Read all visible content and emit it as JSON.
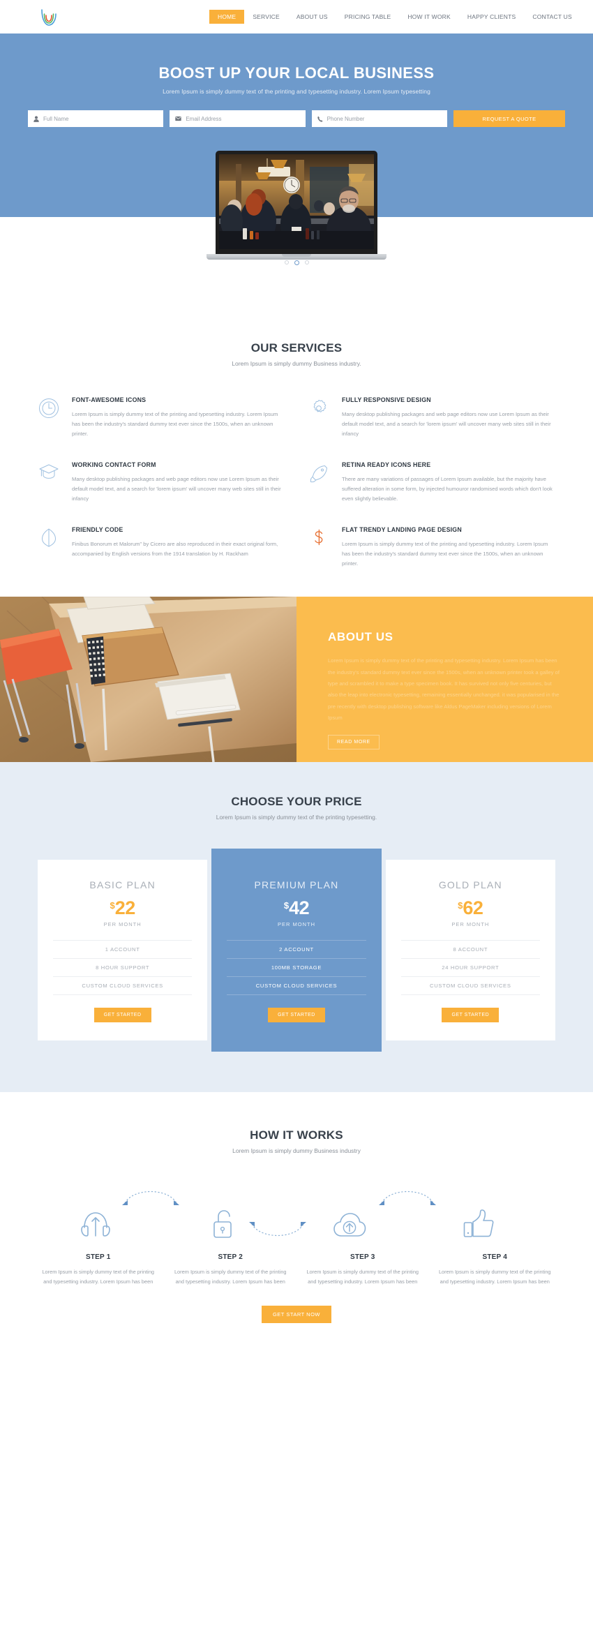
{
  "brand": {
    "logo_name": "rainbow-arc-logo",
    "colors": {
      "accent_orange": "#f9b03a",
      "accent_blue": "#6e9acb",
      "about_yellow": "#fbbc4e",
      "pricing_bg": "#e6edf5",
      "heading": "#38414b",
      "body_text": "#9aa0a8"
    }
  },
  "nav": {
    "items": [
      {
        "label": "HOME",
        "active": true
      },
      {
        "label": "SERVICE",
        "active": false
      },
      {
        "label": "ABOUT US",
        "active": false
      },
      {
        "label": "PRICING TABLE",
        "active": false
      },
      {
        "label": "HOW IT WORK",
        "active": false
      },
      {
        "label": "HAPPY CLIENTS",
        "active": false
      },
      {
        "label": "CONTACT US",
        "active": false
      }
    ]
  },
  "hero": {
    "title": "BOOST UP YOUR LOCAL BUSINESS",
    "subtitle": "Lorem Ipsum is simply dummy text of the printing and typesetting industry. Lorem Ipsum typesetting",
    "fields": [
      {
        "icon": "user-icon",
        "placeholder": "Full Name",
        "value": ""
      },
      {
        "icon": "envelope-icon",
        "placeholder": "Email Address",
        "value": ""
      },
      {
        "icon": "phone-icon",
        "placeholder": "Phone Number",
        "value": ""
      }
    ],
    "submit_label": "REQUEST A QUOTE",
    "carousel": {
      "slides": 3,
      "active_index": 1
    }
  },
  "services": {
    "title": "OUR SERVICES",
    "subtitle": "Lorem Ipsum is simply dummy Business industry.",
    "items": [
      {
        "icon": "clock-circle-icon",
        "title": "FONT-AWESOME ICONS",
        "text": "Lorem Ipsum is simply dummy text of the printing and typesetting industry. Lorem Ipsum has been the industry's standard dummy text ever since the 1500s, when an unknown printer."
      },
      {
        "icon": "gear-icon",
        "title": "FULLY RESPONSIVE DESIGN",
        "text": "Many desktop publishing packages and web page editors now use Lorem Ipsum as their default model text, and a search for 'lorem ipsum' will uncover many web sites still in their infancy"
      },
      {
        "icon": "graduation-cap-icon",
        "title": "WORKING CONTACT FORM",
        "text": "Many desktop publishing packages and web page editors now use Lorem Ipsum as their default model text, and a search for 'lorem ipsum' will uncover many web sites still in their infancy"
      },
      {
        "icon": "rocket-icon",
        "title": "RETINA READY ICONS HERE",
        "text": "There are many variations of passages of Lorem Ipsum available, but the majority have suffered alteration in some form, by injected humouror randomised words which don't look even slightly believable."
      },
      {
        "icon": "leaf-code-icon",
        "title": "FRIENDLY CODE",
        "text": "Finibus Bonorum et Malorum\" by Cicero are also reproduced in their exact original form, accompanied by English versions from the 1914 translation by H. Rackham"
      },
      {
        "icon": "dollar-sign-icon",
        "title": "FLAT TRENDY LANDING PAGE DESIGN",
        "text": "Lorem Ipsum is simply dummy text of the printing and typesetting industry. Lorem Ipsum has been the industry's standard dummy text ever since the 1500s, when an unknown printer."
      }
    ]
  },
  "about": {
    "image_name": "desk-with-notebook-and-orange-chair",
    "title": "ABOUT US",
    "text": "Lorem Ipsum is simply dummy text of the printing and typesetting industry. Lorem Ipsum has been the industry's standard dummy text ever since the 1500s, when an unknown printer took a galley of type and scrambled it to make a type specimen book. It has survived not only five centuries, but also the leap into electronic typesetting, remaining essentially unchanged. it was popularised in the pre recently with desktop publishing software like Aldus PageMaker including versions of Lorem Ipsum",
    "button_label": "READ MORE"
  },
  "pricing": {
    "title": "CHOOSE YOUR PRICE",
    "subtitle": "Lorem Ipsum is simply dummy text of the printing typesetting.",
    "plans": [
      {
        "name": "BASIC PLAN",
        "currency": "$",
        "amount": "22",
        "period": "PER MONTH",
        "features": [
          "1 ACCOUNT",
          "8 HOUR SUPPORT",
          "CUSTOM CLOUD SERVICES"
        ],
        "button_label": "GET STARTED",
        "featured": false
      },
      {
        "name": "PREMIUM PLAN",
        "currency": "$",
        "amount": "42",
        "period": "PER MONTH",
        "features": [
          "2 ACCOUNT",
          "100MB STORAGE",
          "CUSTOM CLOUD SERVICES"
        ],
        "button_label": "GET STARTED",
        "featured": true
      },
      {
        "name": "GOLD PLAN",
        "currency": "$",
        "amount": "62",
        "period": "PER MONTH",
        "features": [
          "8 ACCOUNT",
          "24 HOUR SUPPORT",
          "CUSTOM CLOUD SERVICES"
        ],
        "button_label": "GET STARTED",
        "featured": false
      }
    ]
  },
  "how_it_works": {
    "title": "HOW IT WORKS",
    "subtitle": "Lorem Ipsum is simply dummy Business industry",
    "steps": [
      {
        "icon": "headphones-icon",
        "title": "STEP 1",
        "text": "Lorem Ipsum is simply dummy text of the printing and typesetting industry. Lorem Ipsum has been"
      },
      {
        "icon": "unlock-icon",
        "title": "STEP 2",
        "text": "Lorem Ipsum is simply dummy text of the printing and typesetting industry. Lorem Ipsum has been"
      },
      {
        "icon": "cloud-upload-icon",
        "title": "STEP 3",
        "text": "Lorem Ipsum is simply dummy text of the printing and typesetting industry. Lorem Ipsum has been"
      },
      {
        "icon": "thumbs-up-icon",
        "title": "STEP 4",
        "text": "Lorem Ipsum is simply dummy text of the printing and typesetting industry. Lorem Ipsum has been"
      }
    ],
    "cta_label": "GET START NOW"
  }
}
